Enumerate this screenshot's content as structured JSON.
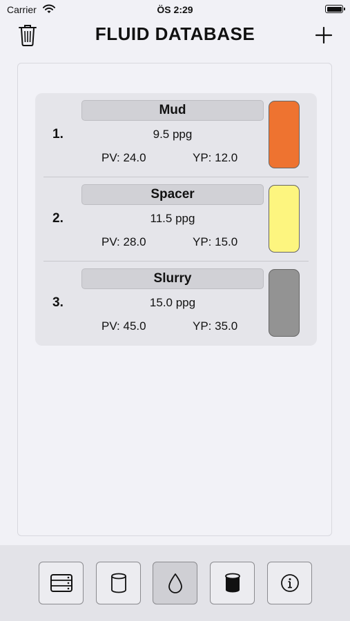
{
  "status_bar": {
    "carrier": "Carrier",
    "time": "ÖS 2:29",
    "icons": [
      "wifi-icon",
      "battery-icon"
    ]
  },
  "header": {
    "title": "FLUID DATABASE",
    "left_icon": "trash-icon",
    "right_icon": "plus-icon"
  },
  "fluids": [
    {
      "index": "1.",
      "name": "Mud",
      "density": "9.5 ppg",
      "pv": "PV: 24.0",
      "yp": "YP: 12.0",
      "color": "#ee7330"
    },
    {
      "index": "2.",
      "name": "Spacer",
      "density": "11.5 ppg",
      "pv": "PV: 28.0",
      "yp": "YP: 15.0",
      "color": "#fdf57f"
    },
    {
      "index": "3.",
      "name": "Slurry",
      "density": "15.0 ppg",
      "pv": "PV: 45.0",
      "yp": "YP: 35.0",
      "color": "#939393"
    }
  ],
  "tabbar": {
    "tabs": [
      {
        "icon": "server-rack-icon",
        "selected": false
      },
      {
        "icon": "cylinder-outline-icon",
        "selected": false
      },
      {
        "icon": "drop-icon",
        "selected": true
      },
      {
        "icon": "cylinder-filled-icon",
        "selected": false
      },
      {
        "icon": "info-icon",
        "selected": false
      }
    ]
  }
}
